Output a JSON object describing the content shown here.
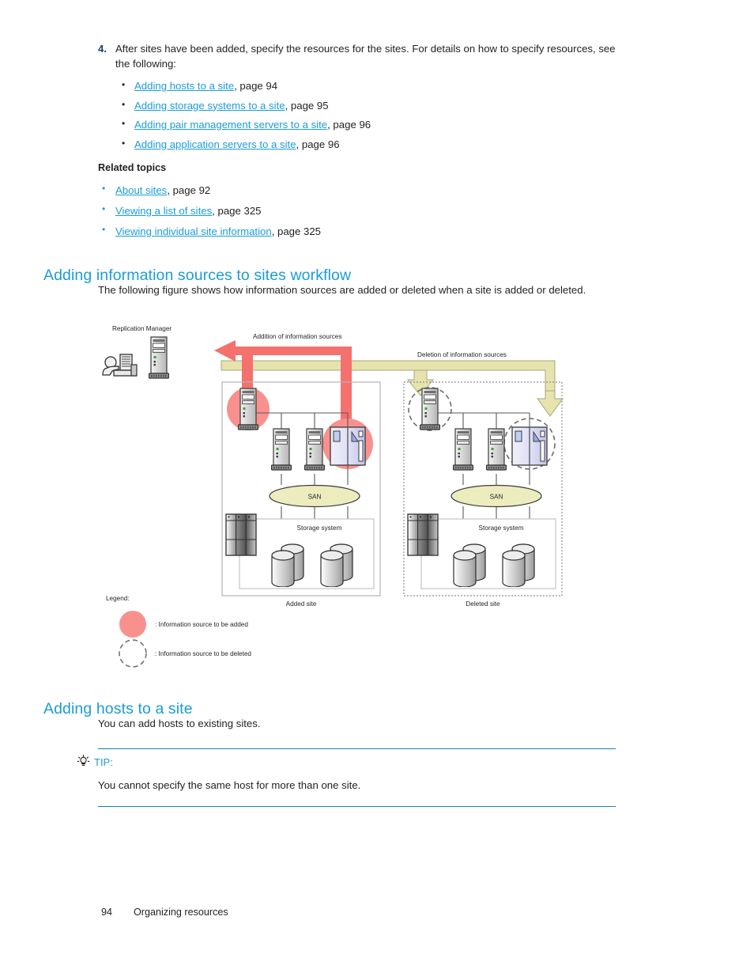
{
  "step": {
    "number": "4.",
    "text": "After sites have been added, specify the resources for the sites. For details on how to specify resources, see the following:",
    "links": [
      {
        "label": "Adding hosts to a site",
        "suffix": ", page 94"
      },
      {
        "label": "Adding storage systems to a site",
        "suffix": ", page 95"
      },
      {
        "label": "Adding pair management servers to a site",
        "suffix": ", page 96"
      },
      {
        "label": "Adding application servers to a site",
        "suffix": ", page 96"
      }
    ]
  },
  "related": {
    "heading": "Related topics",
    "items": [
      {
        "label": "About sites",
        "suffix": ", page 92"
      },
      {
        "label": "Viewing a list of sites",
        "suffix": ", page 325"
      },
      {
        "label": "Viewing individual site information",
        "suffix": ", page 325"
      }
    ]
  },
  "sections": {
    "workflow": {
      "heading": "Adding information sources to sites workflow",
      "paragraph": "The following figure shows how information sources are added or deleted when a site is added or deleted."
    },
    "hosts": {
      "heading": "Adding hosts to a site",
      "paragraph": "You can add hosts to existing sites."
    }
  },
  "tip": {
    "label": "TIP:",
    "text": "You cannot specify the same host for more than one site.",
    "icon": "lightbulb-icon"
  },
  "figure": {
    "replication_manager": "Replication Manager",
    "addition_label": "Addition of information sources",
    "deletion_label": "Deletion of information sources",
    "san_left": "SAN",
    "san_right": "SAN",
    "storage_left": "Storage system",
    "storage_right": "Storage system",
    "added_site": "Added site",
    "deleted_site": "Deleted site",
    "legend_title": "Legend:",
    "legend_added": ": Information source to be added",
    "legend_deleted": ": Information source to be deleted",
    "colors": {
      "add_arrow": "#F4716E",
      "delete_arrow": "#E6E3AE",
      "san_fill": "#EDEDBE",
      "app_server": "#DCDCF5",
      "server_body": "#C8C8C8"
    }
  },
  "footer": {
    "page_number": "94",
    "chapter": "Organizing resources"
  },
  "theme": {
    "link_color": "#1b9cd8",
    "heading_color": "#1b9cd8",
    "step_num_color": "#1a3f6f",
    "text_color": "#231f20",
    "rule_color": "#1b7fb8"
  }
}
